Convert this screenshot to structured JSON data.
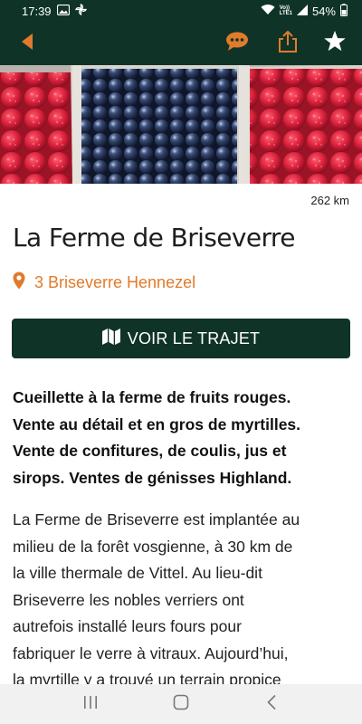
{
  "status": {
    "time": "17:39",
    "battery": "54%",
    "network_label": "Vo))\nLTE1"
  },
  "colors": {
    "header_bg": "#0f3427",
    "accent": "#e07b2c",
    "button_bg": "#0f3427"
  },
  "icons": {
    "back": "back-arrow-icon",
    "chat": "chat-bubble-icon",
    "share": "share-icon",
    "favorite": "star-icon",
    "location": "location-pin-icon",
    "map": "map-icon"
  },
  "place": {
    "distance": "262 km",
    "title": "La Ferme de Briseverre",
    "address": "3 Briseverre Hennezel",
    "route_button": "VOIR LE TRAJET",
    "intro_lines": [
      "Cueillette à la ferme de fruits rouges.",
      "Vente au détail et en gros de myrtilles.",
      "Vente de confitures, de coulis, jus et",
      "sirops. Ventes de génisses Highland."
    ],
    "description_lines": [
      "La Ferme de Briseverre est implantée au",
      "milieu de la forêt vosgienne, à 30 km de",
      "la ville thermale de Vittel. Au lieu-dit",
      "Briseverre les nobles verriers ont",
      "autrefois installé leurs fours pour",
      "fabriquer le verre à vitraux. Aujourd’hui,",
      "la myrtille y a trouvé un terrain propice"
    ]
  }
}
